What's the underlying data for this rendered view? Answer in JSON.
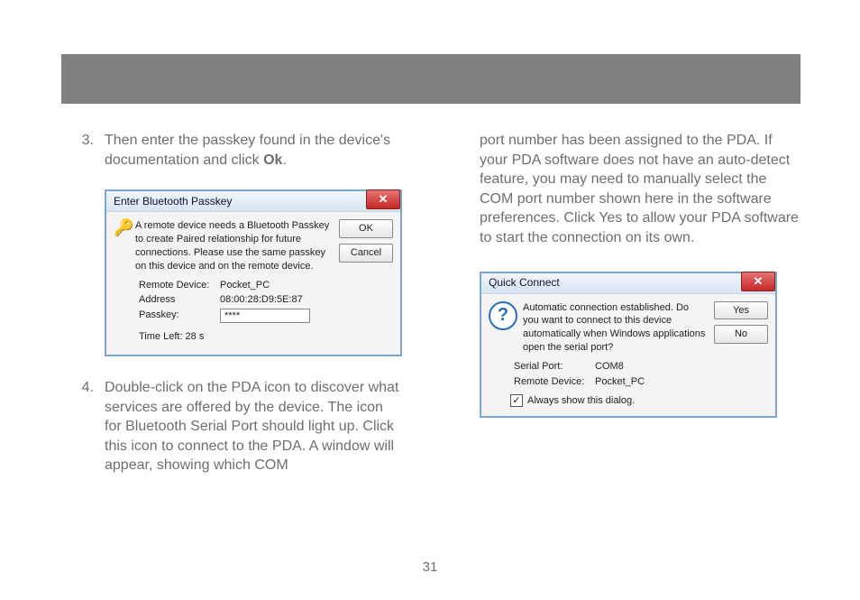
{
  "header_bar": "",
  "left": {
    "items": [
      {
        "num": "3.",
        "text_a": "Then enter the passkey found in the device's documentation and click ",
        "bold": "Ok",
        "text_b": "."
      },
      {
        "num": "4.",
        "text_a": "Double-click on the PDA icon to discover what services are offered by the device. The icon for Bluetooth Serial Port should light up. Click this icon to connect to the PDA. A window will appear, showing which COM",
        "bold": "",
        "text_b": ""
      }
    ]
  },
  "right": {
    "cont_text": "port number has been assigned to the PDA. If your PDA software does not have an auto-detect feature, you may need to manually select the COM port number shown here in the software preferences. Click Yes to allow your PDA software to start the connection on its own."
  },
  "dialog1": {
    "title": "Enter Bluetooth Passkey",
    "message": "A remote device needs a Bluetooth Passkey to create Paired relationship for future connections. Please use the same passkey on this device and on the remote device.",
    "btn_ok": "OK",
    "btn_cancel": "Cancel",
    "fields": {
      "remote_label": "Remote Device:",
      "remote_value": "Pocket_PC",
      "address_label": "Address",
      "address_value": "08:00:28:D9:5E:87",
      "passkey_label": "Passkey:",
      "passkey_value": "****",
      "timeleft_label": "Time Left: 28 s"
    }
  },
  "dialog2": {
    "title": "Quick Connect",
    "message": "Automatic connection established. Do you want to connect to this device automatically when Windows applications open the serial port?",
    "btn_yes": "Yes",
    "btn_no": "No",
    "fields": {
      "serial_label": "Serial Port:",
      "serial_value": "COM8",
      "remote_label": "Remote Device:",
      "remote_value": "Pocket_PC"
    },
    "checkbox_label": "Always show this dialog.",
    "checkbox_checked": "✓"
  },
  "page_number": "31"
}
